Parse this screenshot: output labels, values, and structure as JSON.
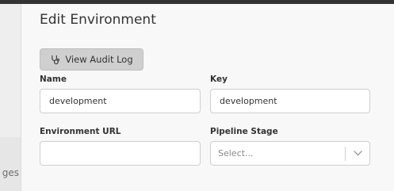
{
  "sidebar": {
    "partial_label": "ges"
  },
  "page": {
    "title": "Edit Environment"
  },
  "audit_log": {
    "label": "View Audit Log",
    "icon": "stethoscope-icon"
  },
  "form": {
    "name": {
      "label": "Name",
      "value": "development"
    },
    "key": {
      "label": "Key",
      "value": "development"
    },
    "environment_url": {
      "label": "Environment URL",
      "value": ""
    },
    "pipeline_stage": {
      "label": "Pipeline Stage",
      "placeholder": "Select..."
    }
  },
  "colors": {
    "topbar": "#333333",
    "button_bg": "#cfcfcf",
    "text": "#333333",
    "placeholder": "#8a8a8a"
  }
}
